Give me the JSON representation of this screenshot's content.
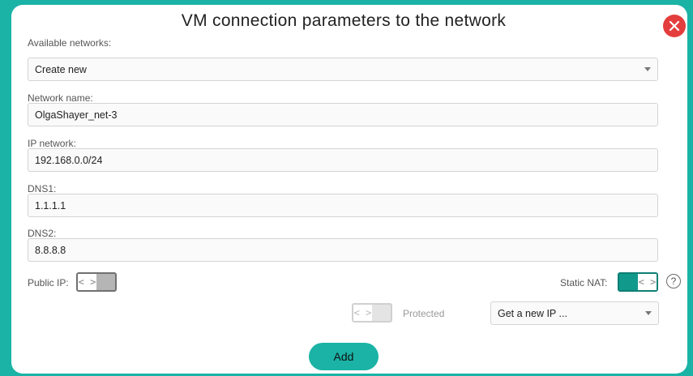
{
  "dialog": {
    "title": "VM connection parameters to the network",
    "close_icon": "close-icon"
  },
  "available_networks": {
    "label": "Available networks:",
    "value": "Create new"
  },
  "network_name": {
    "label": "Network name:",
    "value": "OlgaShayer_net-3"
  },
  "ip_network": {
    "label": "IP network:",
    "value": "192.168.0.0/24"
  },
  "dns1": {
    "label": "DNS1:",
    "value": "1.1.1.1"
  },
  "dns2": {
    "label": "DNS2:",
    "value": "8.8.8.8"
  },
  "public_ip": {
    "label": "Public IP:",
    "state": "off",
    "knob": "< >"
  },
  "static_nat": {
    "label": "Static NAT:",
    "state": "on",
    "knob": "< >",
    "help_icon": "help-icon",
    "help_glyph": "?"
  },
  "protected": {
    "label": "Protected",
    "state": "disabled",
    "knob": "< >"
  },
  "ip_select": {
    "value": "Get a new IP ..."
  },
  "actions": {
    "add_label": "Add"
  },
  "colors": {
    "accent": "#1ab3a6",
    "close": "#e43d3d",
    "toggle_on": "#119a8c"
  }
}
